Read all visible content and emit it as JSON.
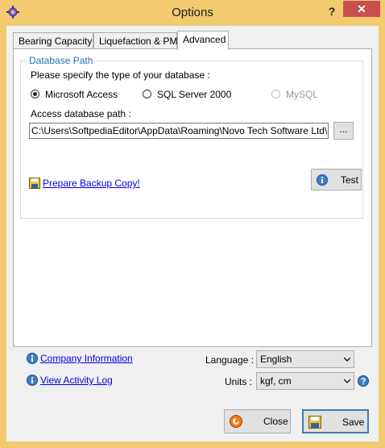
{
  "window": {
    "title": "Options",
    "help_label": "?",
    "close_label": "✕"
  },
  "tabs": [
    {
      "label": "Bearing Capacity"
    },
    {
      "label": "Liquefaction & PMT"
    },
    {
      "label": "Advanced",
      "active": true
    }
  ],
  "database": {
    "group_label": "Database Path",
    "prompt": "Please specify the type of your database :",
    "options": [
      {
        "label": "Microsoft Access",
        "selected": true
      },
      {
        "label": "SQL Server 2000",
        "selected": false
      },
      {
        "label": "MySQL",
        "selected": false,
        "disabled": true
      }
    ],
    "path_label": "Access database path :",
    "path_value": "C:\\Users\\SoftpediaEditor\\AppData\\Roaming\\Novo Tech Software Ltd\\Peysaz",
    "browse_label": "...",
    "backup_link": "Prepare Backup Copy!",
    "test_label": "Test"
  },
  "footer": {
    "company_link": "Company Information",
    "activity_link": "View Activity Log",
    "language_label": "Language :",
    "language_value": "English",
    "units_label": "Units :",
    "units_value": "kgf, cm",
    "close_label": "Close",
    "save_label": "Save"
  },
  "colors": {
    "frame": "#f2ca70",
    "close_button": "#c7504f",
    "link": "#0000e6",
    "info_icon": "#3d7ec9"
  }
}
